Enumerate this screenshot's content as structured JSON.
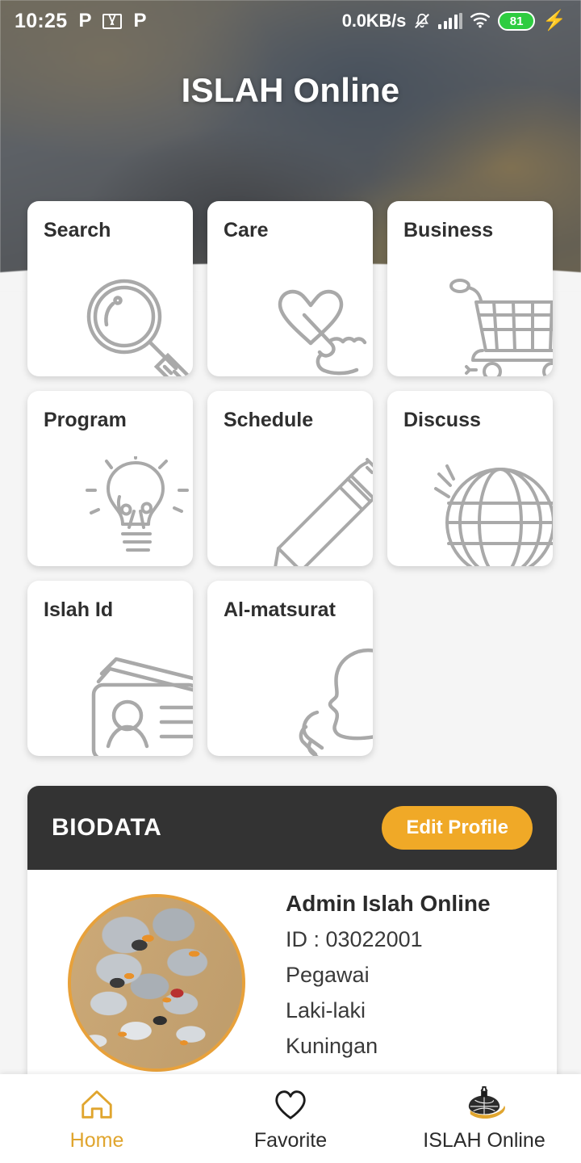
{
  "statusbar": {
    "time": "10:25",
    "app_icon_1": "p-app-icon",
    "app_icon_2": "gmail-icon",
    "app_icon_3": "p-app-icon",
    "network_speed": "0.0KB/s",
    "mute_icon": "bell-muted-icon",
    "signal_icon": "signal-bars-icon",
    "wifi_icon": "wifi-icon",
    "battery_level": "81",
    "charging_icon": "lightning-bolt-icon"
  },
  "header": {
    "title": "ISLAH Online"
  },
  "menu": {
    "items": [
      {
        "label": "Search",
        "icon": "magnifying-glass-icon"
      },
      {
        "label": "Care",
        "icon": "heart-hand-icon"
      },
      {
        "label": "Business",
        "icon": "shopping-cart-icon"
      },
      {
        "label": "Program",
        "icon": "lightbulb-icon"
      },
      {
        "label": "Schedule",
        "icon": "pencil-icon"
      },
      {
        "label": "Discuss",
        "icon": "globe-icon"
      },
      {
        "label": "Islah Id",
        "icon": "id-card-icon"
      },
      {
        "label": "Al-matsurat",
        "icon": "praying-person-icon"
      }
    ]
  },
  "biodata": {
    "title": "BIODATA",
    "edit_button": "Edit Profile",
    "avatar": "profile-photo",
    "name": "Admin Islah Online",
    "id": "ID : 03022001",
    "role": "Pegawai",
    "gender": "Laki-laki",
    "city": "Kuningan"
  },
  "bottomnav": {
    "items": [
      {
        "label": "Home",
        "icon": "home-icon",
        "active": true
      },
      {
        "label": "Favorite",
        "icon": "heart-icon",
        "active": false
      },
      {
        "label": "ISLAH Online",
        "icon": "islah-logo-icon",
        "active": false
      }
    ]
  },
  "colors": {
    "accent": "#f0a927",
    "dark": "#333333",
    "page_bg": "#f5f5f5",
    "battery_green": "#2ecc40"
  }
}
